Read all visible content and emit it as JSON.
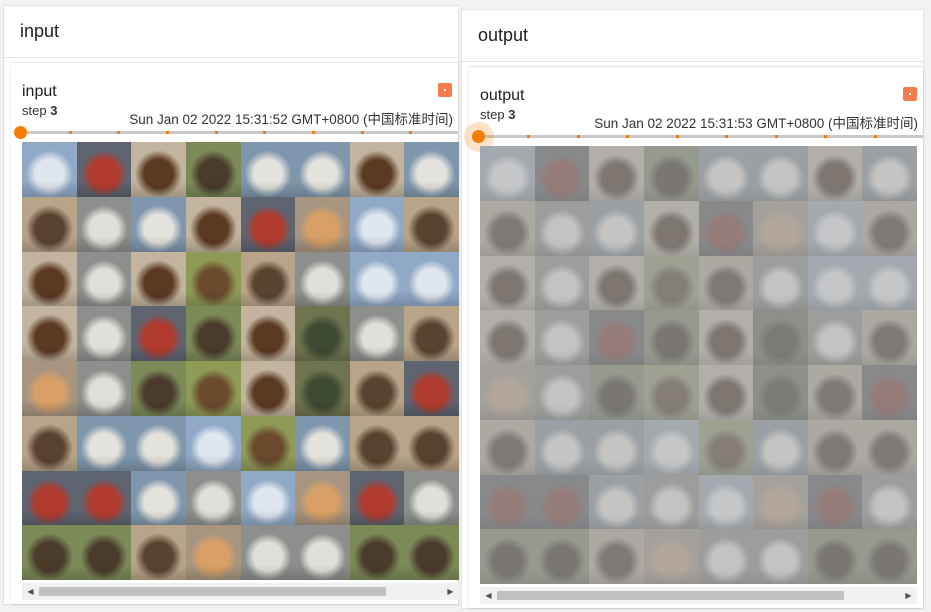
{
  "panels": [
    {
      "id": "input",
      "header": "input",
      "card": {
        "tag": "input",
        "step_label": "step",
        "step_value": "3",
        "timestamp": "Sun Jan 02 2022 15:31:52 GMT+0800 (中国标准时间)",
        "slider_position": 0,
        "scroll_fraction": 0.86
      }
    },
    {
      "id": "output",
      "header": "output",
      "card": {
        "tag": "output",
        "step_label": "step",
        "step_value": "3",
        "timestamp": "Sun Jan 02 2022 15:31:53 GMT+0800 (中国标准时间)",
        "slider_position": 0,
        "scroll_fraction": 0.86
      }
    }
  ],
  "colors": {
    "accent": "#f57c00",
    "expand_button": "#f57c4a",
    "panel_border": "#e3e3e3"
  },
  "image_grid": {
    "rows": 8,
    "cols": 8,
    "cells": [
      [
        "airplane",
        "automobile",
        "horse",
        "bird",
        "ship",
        "ship",
        "horse",
        "ship"
      ],
      [
        "dog",
        "truck",
        "ship",
        "horse",
        "automobile",
        "cat",
        "airplane",
        "dog"
      ],
      [
        "horse",
        "truck",
        "horse",
        "deer",
        "dog",
        "truck",
        "airplane",
        "airplane"
      ],
      [
        "horse",
        "truck",
        "automobile",
        "bird",
        "horse",
        "frog",
        "truck",
        "dog"
      ],
      [
        "cat",
        "truck",
        "bird",
        "deer",
        "horse",
        "frog",
        "dog",
        "automobile"
      ],
      [
        "dog",
        "ship",
        "ship",
        "airplane",
        "deer",
        "ship",
        "dog",
        "dog"
      ],
      [
        "automobile",
        "automobile",
        "ship",
        "truck",
        "airplane",
        "cat",
        "automobile",
        "truck"
      ],
      [
        "bird",
        "bird",
        "dog",
        "cat",
        "truck",
        "truck",
        "bird",
        "bird"
      ]
    ],
    "palette": {
      "airplane": [
        "#8fa9c7",
        "#dfe6ee"
      ],
      "automobile": [
        "#5e6470",
        "#b23b2f"
      ],
      "bird": [
        "#7c8a58",
        "#4a3b2b"
      ],
      "cat": [
        "#a79580",
        "#d9a066"
      ],
      "deer": [
        "#8f9a57",
        "#6b4a2e"
      ],
      "dog": [
        "#b8a488",
        "#5a4230"
      ],
      "frog": [
        "#6f7450",
        "#3e4a32"
      ],
      "horse": [
        "#c2b49e",
        "#5b3a22"
      ],
      "ship": [
        "#7f97ad",
        "#e4e2dc"
      ],
      "truck": [
        "#8d8f8c",
        "#e0dfdb"
      ]
    }
  }
}
